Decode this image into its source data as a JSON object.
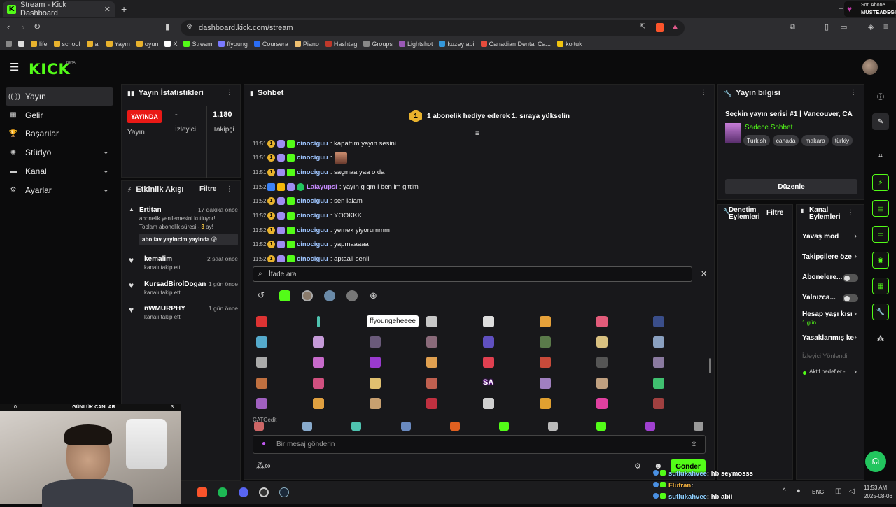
{
  "browser": {
    "tab_title": "Stream - Kick Dashboard",
    "url": "dashboard.kick.com/stream",
    "bookmarks": [
      "life",
      "school",
      "ai",
      "Yayın",
      "oyun",
      "X",
      "Stream",
      "ffyoung",
      "Coursera",
      "Piano",
      "Hashtag",
      "Groups",
      "Lightshot",
      "kuzey abi",
      "Canadian Dental Ca...",
      "koltuk"
    ],
    "corner_label": "Son Abone",
    "corner_name": "MUSTEADEGIL"
  },
  "app": {
    "logo": "KICK",
    "beta": "BETA"
  },
  "sidebar": {
    "items": [
      {
        "label": "Yayın",
        "icon": "broadcast-icon"
      },
      {
        "label": "Gelir",
        "icon": "revenue-icon"
      },
      {
        "label": "Başarılar",
        "icon": "trophy-icon"
      },
      {
        "label": "Stüdyo",
        "icon": "studio-icon"
      },
      {
        "label": "Kanal",
        "icon": "channel-icon"
      },
      {
        "label": "Ayarlar",
        "icon": "settings-icon"
      }
    ]
  },
  "stats": {
    "title": "Yayın İstatistikleri",
    "live_badge": "YAYINDA",
    "live_label": "Yayın",
    "viewers_value": "-",
    "viewers_label": "İzleyici",
    "followers_value": "1.180",
    "followers_label": "Takipçi"
  },
  "activity": {
    "title": "Etkinlik Akışı",
    "filter": "Filtre",
    "events": [
      {
        "name": "Ertitan",
        "time": "17 dakika önce",
        "line1": "abonelik yenilemesini kutluyor!",
        "line2": "Toplam abonelik süresi - ",
        "months": "3",
        "line2_suffix": " ay!",
        "message": "abo fav yayincim yayinda 😝"
      },
      {
        "name": "kemalim",
        "time": "2 saat önce",
        "line1": "kanalı takip etti"
      },
      {
        "name": "KursadBirolDogan",
        "time": "1 gün önce",
        "line1": "kanalı takip etti"
      },
      {
        "name": "nWMURPHY",
        "time": "1 gün önce",
        "line1": "kanalı takip etti"
      }
    ]
  },
  "chat": {
    "title": "Sohbet",
    "promo": "1 abonelik hediye ederek 1. sıraya yükselin",
    "promo_badge": "1",
    "messages": [
      {
        "time": "11:51",
        "user": "cinociguu",
        "text": ": kapattım yayın sesini"
      },
      {
        "time": "11:51",
        "user": "cinociguu",
        "text": ":"
      },
      {
        "time": "11:51",
        "user": "cinociguu",
        "text": ": saçmaa yaa o da"
      },
      {
        "time": "11:52",
        "user": "Lalayupsi",
        "text": ": yayın g gm i ben im gittim"
      },
      {
        "time": "11:52",
        "user": "cinociguu",
        "text": ": sen lalam"
      },
      {
        "time": "11:52",
        "user": "cinociguu",
        "text": ": YOOKKK"
      },
      {
        "time": "11:52",
        "user": "cinociguu",
        "text": ": yemek yiyorummm"
      },
      {
        "time": "11:52",
        "user": "cinociguu",
        "text": ": yapmaaaaa"
      },
      {
        "time": "11:52",
        "user": "cinociguu",
        "text": ": aptaall senii"
      }
    ],
    "emote_search_placeholder": "İfade ara",
    "tooltip": "ffyoungeheeee",
    "section_label": "CATOedit",
    "emote_sa": "SA",
    "message_placeholder": "Bir mesaj gönderin",
    "send_label": "Gönder"
  },
  "stream_info": {
    "title": "Yayın bilgisi",
    "stream_title": "Seçkin yayın serisi #1 | Vancouver, CA",
    "category": "Sadece Sohbet",
    "tags": [
      "Turkish",
      "canada",
      "makara",
      "türkiy"
    ],
    "edit_label": "Düzenle"
  },
  "mod": {
    "title_line1": "Denetim",
    "title_line2": "Eylemleri",
    "filter": "Filtre"
  },
  "channel_actions": {
    "title_line1": "Kanal",
    "title_line2": "Eylemleri",
    "items": [
      {
        "label": "Yavaş mod",
        "type": "arrow"
      },
      {
        "label": "Takipçilere öze",
        "type": "arrow"
      },
      {
        "label": "Abonelere...",
        "type": "toggle"
      },
      {
        "label": "Yalnızca...",
        "type": "toggle"
      },
      {
        "label": "Hesap yaşı kısı",
        "sub": "1 gün",
        "type": "arrow"
      },
      {
        "label": "Yasaklanmış ke",
        "type": "arrow"
      },
      {
        "label": "İzleyici Yönlendir",
        "type": "disabled"
      },
      {
        "label": "Aktif hedefler -",
        "type": "arrow"
      }
    ]
  },
  "webcam": {
    "left_num": "0",
    "label": "GÜNLÜK CANLAR",
    "right_num": "3"
  },
  "overlay_chat": [
    {
      "user": "sutlukahvee",
      "text": ": hb seymosss"
    },
    {
      "user": "Flufran",
      "text": ":"
    },
    {
      "user": "sutlukahvee",
      "text": ": hb abii"
    }
  ],
  "taskbar": {
    "lang": "ENG",
    "time": "11:53 AM",
    "date": "2025-08-06"
  },
  "colors": {
    "accent": "#53fc18",
    "live": "#e91916",
    "panel": "#18181b"
  }
}
